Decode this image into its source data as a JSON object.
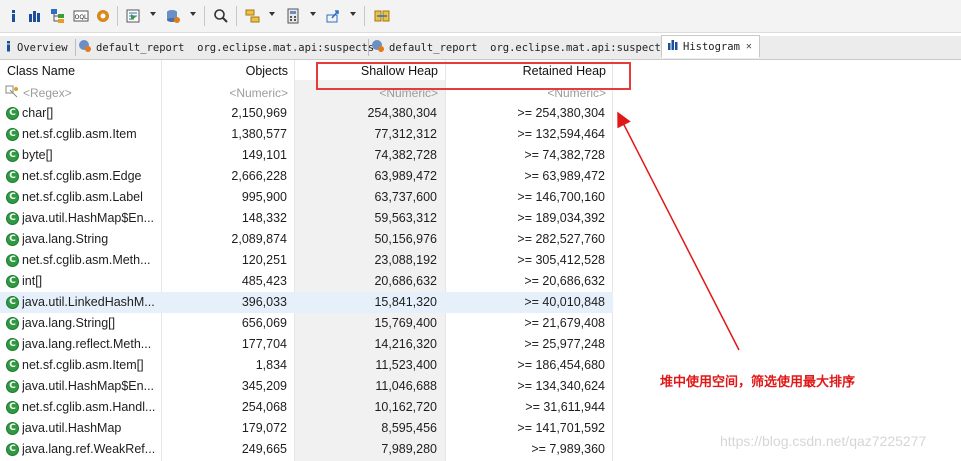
{
  "toolbar": {
    "icons": [
      "info-icon",
      "histogram-icon",
      "dominator-tree-icon",
      "oql-icon",
      "heap-dump-overview-icon",
      "run-report-icon",
      "query-browser-icon",
      "search-icon",
      "group-by-icon",
      "calculator-icon",
      "export-icon",
      "compare-icon"
    ]
  },
  "tabs": [
    {
      "label": "Overview"
    },
    {
      "label": "default_report  org.eclipse.mat.api:suspects"
    },
    {
      "label": "default_report  org.eclipse.mat.api:suspects"
    },
    {
      "label": "Histogram",
      "close": "✕"
    }
  ],
  "histogram": {
    "columns": {
      "class_name": "Class Name",
      "objects": "Objects",
      "shallow_heap": "Shallow Heap",
      "retained_heap": "Retained Heap"
    },
    "filters": {
      "class_name": "<Regex>",
      "objects": "<Numeric>",
      "shallow_heap": "<Numeric>",
      "retained_heap": "<Numeric>"
    },
    "rows": [
      {
        "name": "char[]",
        "objects": "2,150,969",
        "shallow": "254,380,304",
        "retained": ">= 254,380,304"
      },
      {
        "name": "net.sf.cglib.asm.Item",
        "objects": "1,380,577",
        "shallow": "77,312,312",
        "retained": ">= 132,594,464"
      },
      {
        "name": "byte[]",
        "objects": "149,101",
        "shallow": "74,382,728",
        "retained": ">= 74,382,728"
      },
      {
        "name": "net.sf.cglib.asm.Edge",
        "objects": "2,666,228",
        "shallow": "63,989,472",
        "retained": ">= 63,989,472"
      },
      {
        "name": "net.sf.cglib.asm.Label",
        "objects": "995,900",
        "shallow": "63,737,600",
        "retained": ">= 146,700,160"
      },
      {
        "name": "java.util.HashMap$En...",
        "objects": "148,332",
        "shallow": "59,563,312",
        "retained": ">= 189,034,392"
      },
      {
        "name": "java.lang.String",
        "objects": "2,089,874",
        "shallow": "50,156,976",
        "retained": ">= 282,527,760"
      },
      {
        "name": "net.sf.cglib.asm.Meth...",
        "objects": "120,251",
        "shallow": "23,088,192",
        "retained": ">= 305,412,528"
      },
      {
        "name": "int[]",
        "objects": "485,423",
        "shallow": "20,686,632",
        "retained": ">= 20,686,632"
      },
      {
        "name": "java.util.LinkedHashM...",
        "objects": "396,033",
        "shallow": "15,841,320",
        "retained": ">= 40,010,848",
        "selected": true
      },
      {
        "name": "java.lang.String[]",
        "objects": "656,069",
        "shallow": "15,769,400",
        "retained": ">= 21,679,408"
      },
      {
        "name": "java.lang.reflect.Meth...",
        "objects": "177,704",
        "shallow": "14,216,320",
        "retained": ">= 25,977,248"
      },
      {
        "name": "net.sf.cglib.asm.Item[]",
        "objects": "1,834",
        "shallow": "11,523,400",
        "retained": ">= 186,454,680"
      },
      {
        "name": "java.util.HashMap$En...",
        "objects": "345,209",
        "shallow": "11,046,688",
        "retained": ">= 134,340,624"
      },
      {
        "name": "net.sf.cglib.asm.Handl...",
        "objects": "254,068",
        "shallow": "10,162,720",
        "retained": ">= 31,611,944"
      },
      {
        "name": "java.util.HashMap",
        "objects": "179,072",
        "shallow": "8,595,456",
        "retained": ">= 141,701,592"
      },
      {
        "name": "java.lang.ref.WeakRef...",
        "objects": "249,665",
        "shallow": "7,989,280",
        "retained": ">= 7,989,360"
      }
    ],
    "class_icon_letter": "C"
  },
  "annotation": {
    "text": "堆中使用空间，筛选使用最大排序",
    "color": "#e01818"
  },
  "watermark": "https://blog.csdn.net/qaz7225277",
  "colors": {
    "accent_red": "#e53b3b",
    "class_icon_green": "#2f9a41",
    "selected_row": "#e6f0fa"
  }
}
